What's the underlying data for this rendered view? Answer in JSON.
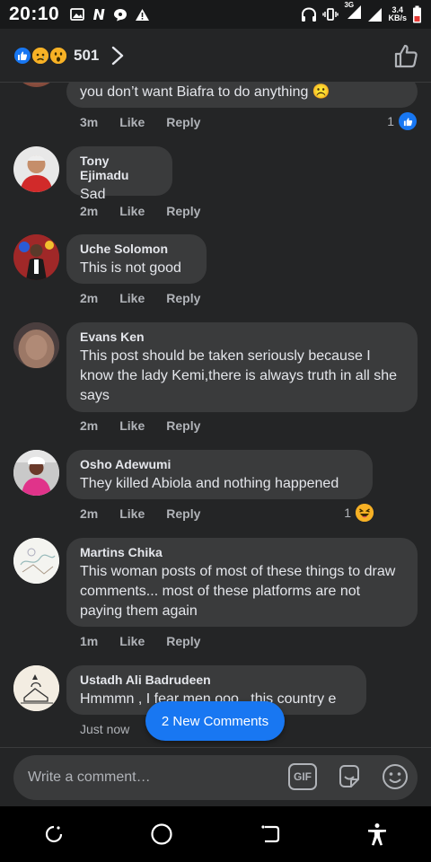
{
  "status_bar": {
    "time": "20:10",
    "network_type": "3G",
    "net_speed_value": "3.4",
    "net_speed_unit": "KB/s"
  },
  "reactions_header": {
    "count": "501",
    "reactions": [
      "like",
      "sad",
      "wow"
    ]
  },
  "comments": [
    {
      "author": "",
      "text": "you don’t want Biafra to do anything ☹️",
      "time": "3m",
      "like_label": "Like",
      "reply_label": "Reply",
      "reaction_count": "1",
      "reaction": "like"
    },
    {
      "author": "Tony Ejimadu",
      "text": "Sad",
      "time": "2m",
      "like_label": "Like",
      "reply_label": "Reply"
    },
    {
      "author": "Uche Solomon",
      "text": "This is not good",
      "time": "2m",
      "like_label": "Like",
      "reply_label": "Reply"
    },
    {
      "author": "Evans Ken",
      "text": "This post should be taken seriously because I know the lady Kemi,there is always truth in all she says",
      "time": "2m",
      "like_label": "Like",
      "reply_label": "Reply"
    },
    {
      "author": "Osho Adewumi",
      "text": "They killed Abiola and nothing happened",
      "time": "2m",
      "like_label": "Like",
      "reply_label": "Reply",
      "reaction_count": "1",
      "reaction": "haha"
    },
    {
      "author": "Martins Chika",
      "text": "This woman posts of most of these things to draw comments... most of these platforms are not paying them again",
      "time": "1m",
      "like_label": "Like",
      "reply_label": "Reply"
    },
    {
      "author": "Ustadh Ali Badrudeen",
      "text": "Hmmmn , I fear men ooo , this country e",
      "time": "Just now"
    }
  ],
  "new_comments_pill": "2 New Comments",
  "composer": {
    "placeholder": "Write a comment…",
    "gif_label": "GIF"
  },
  "colors": {
    "background": "#242526",
    "bubble": "#3a3b3c",
    "accent": "#1877f2",
    "meta_text": "#b0b3b8"
  }
}
